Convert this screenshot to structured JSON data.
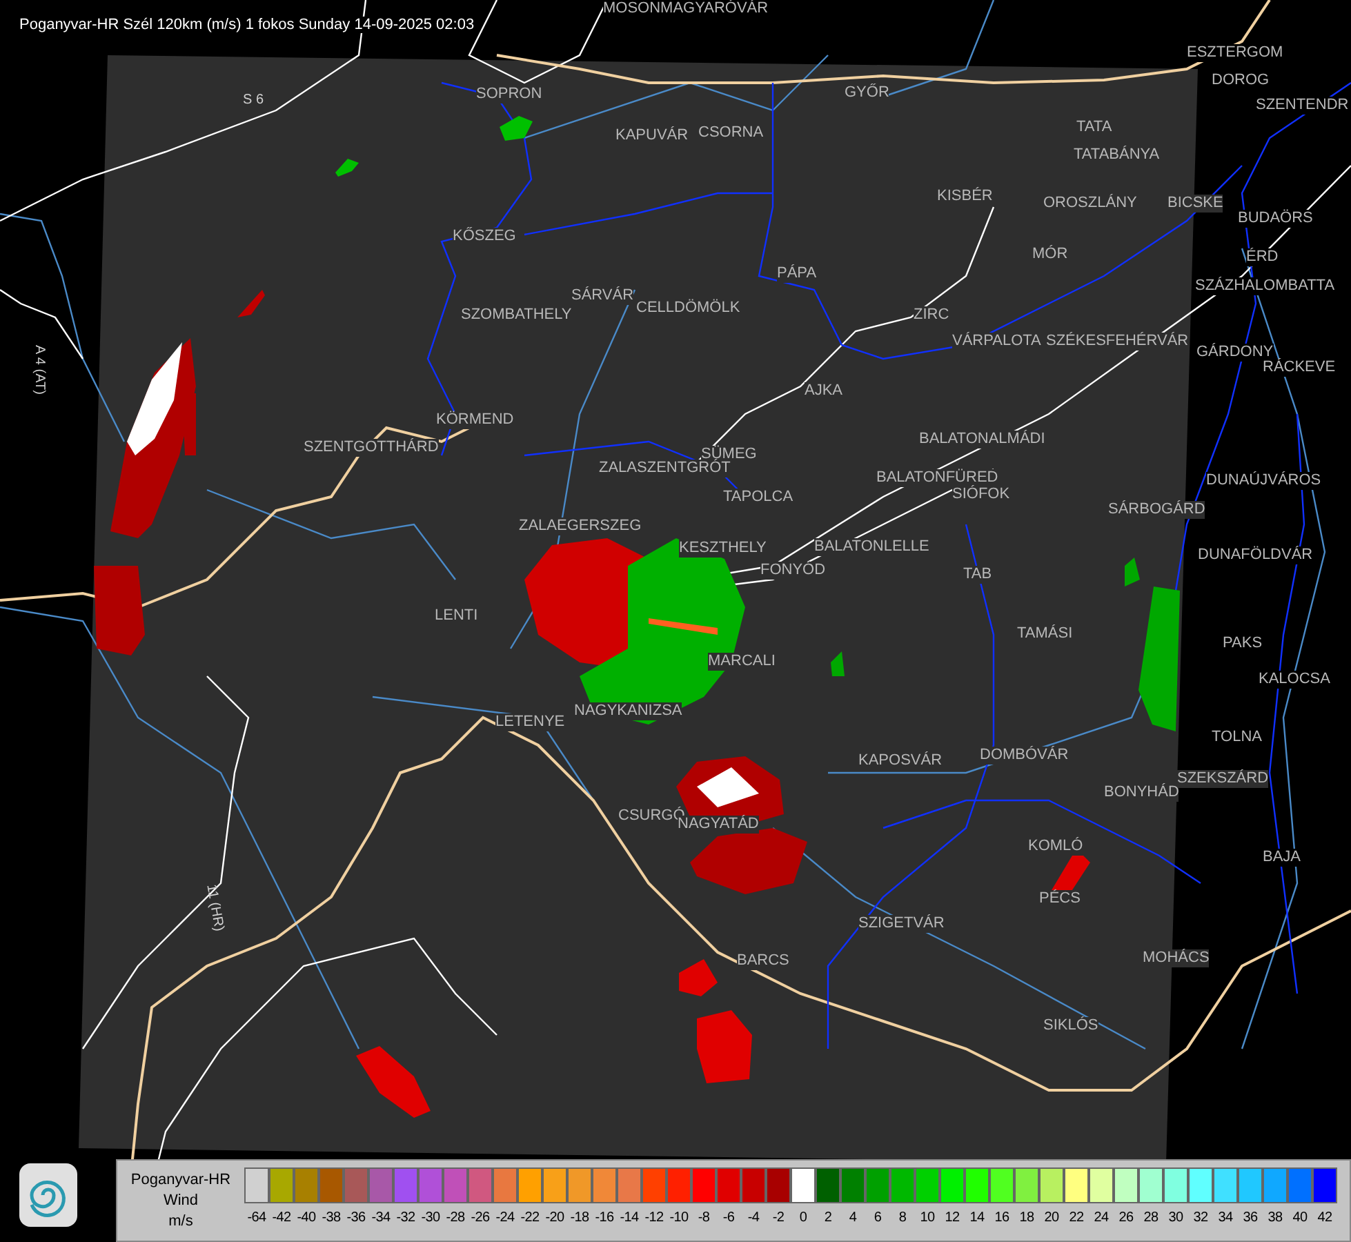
{
  "title": "Poganyvar-HR Szél 120km (m/s) 1 fokos Sunday 14-09-2025 02:03",
  "map_labels": [
    {
      "text": "MOSONMAGYARÓVÁR"
    },
    {
      "text": "SOPRON"
    },
    {
      "text": "GYŐR"
    },
    {
      "text": "KAPUVÁR"
    },
    {
      "text": "CSORNA"
    },
    {
      "text": "ESZTERGOM"
    },
    {
      "text": "DOROG"
    },
    {
      "text": "SZENTENDR"
    },
    {
      "text": "TATA"
    },
    {
      "text": "TATABÁNYA"
    },
    {
      "text": "KISBÉR"
    },
    {
      "text": "OROSZLÁNY"
    },
    {
      "text": "BICSKE"
    },
    {
      "text": "BUDAÖRS"
    },
    {
      "text": "MÓR"
    },
    {
      "text": "ÉRD"
    },
    {
      "text": "SZÁZHALOMBATTA"
    },
    {
      "text": "PÁPA"
    },
    {
      "text": "KŐSZEG"
    },
    {
      "text": "SZOMBATHELY"
    },
    {
      "text": "SÁRVÁR"
    },
    {
      "text": "CELLDÖMÖLK"
    },
    {
      "text": "ZIRC"
    },
    {
      "text": "VÁRPALOTA"
    },
    {
      "text": "SZÉKESFEHÉRVÁR"
    },
    {
      "text": "GÁRDONY"
    },
    {
      "text": "RÁCKEVE"
    },
    {
      "text": "AJKA"
    },
    {
      "text": "KÖRMEND"
    },
    {
      "text": "SZENTGOTTHÁRD"
    },
    {
      "text": "BALATONALMÁDI"
    },
    {
      "text": "SÜMEG"
    },
    {
      "text": "ZALASZENTGRÓT"
    },
    {
      "text": "BALATONFÜRED"
    },
    {
      "text": "SIÓFOK"
    },
    {
      "text": "DUNAÚJVÁROS"
    },
    {
      "text": "TAPOLCA"
    },
    {
      "text": "SÁRBOGÁRD"
    },
    {
      "text": "ZALAEGERSZEG"
    },
    {
      "text": "KESZTHELY"
    },
    {
      "text": "BALATONLELLE"
    },
    {
      "text": "FONYÓD"
    },
    {
      "text": "DUNAFÖLDVÁR"
    },
    {
      "text": "TAB"
    },
    {
      "text": "TAMÁSI"
    },
    {
      "text": "PAKS"
    },
    {
      "text": "LENTI"
    },
    {
      "text": "MARCALI"
    },
    {
      "text": "KALOCSA"
    },
    {
      "text": "NAGYKANIZSA"
    },
    {
      "text": "LETENYE"
    },
    {
      "text": "TOLNA"
    },
    {
      "text": "KAPOSVÁR"
    },
    {
      "text": "DOMBÓVÁR"
    },
    {
      "text": "SZEKSZÁRD"
    },
    {
      "text": "BONYHÁD"
    },
    {
      "text": "CSURGÓ"
    },
    {
      "text": "NAGYATÁD"
    },
    {
      "text": "KOMLÓ"
    },
    {
      "text": "BAJA"
    },
    {
      "text": "PÉCS"
    },
    {
      "text": "SZIGETVÁR"
    },
    {
      "text": "MOHÁCS"
    },
    {
      "text": "BARCS"
    },
    {
      "text": "SIKLÓS"
    }
  ],
  "road_labels": [
    {
      "text": "S 6"
    },
    {
      "text": "A 4 (AT)"
    },
    {
      "text": "11 (HR)"
    }
  ],
  "legend": {
    "title": "Poganyvar-HR",
    "subtitle": "Wind",
    "unit": "m/s",
    "items": [
      {
        "label": "-64",
        "color": "#d0d0d0"
      },
      {
        "label": "-42",
        "color": "#a8a800"
      },
      {
        "label": "-40",
        "color": "#a88000"
      },
      {
        "label": "-38",
        "color": "#a85800"
      },
      {
        "label": "-36",
        "color": "#a85858"
      },
      {
        "label": "-34",
        "color": "#a858a8"
      },
      {
        "label": "-32",
        "color": "#a050f0"
      },
      {
        "label": "-30",
        "color": "#b050d8"
      },
      {
        "label": "-28",
        "color": "#c050b8"
      },
      {
        "label": "-26",
        "color": "#d05880"
      },
      {
        "label": "-24",
        "color": "#e87840"
      },
      {
        "label": "-22",
        "color": "#ffa000"
      },
      {
        "label": "-20",
        "color": "#f8a018"
      },
      {
        "label": "-18",
        "color": "#f09828"
      },
      {
        "label": "-16",
        "color": "#f08838"
      },
      {
        "label": "-14",
        "color": "#e87848"
      },
      {
        "label": "-12",
        "color": "#ff4000"
      },
      {
        "label": "-10",
        "color": "#ff2000"
      },
      {
        "label": "-8",
        "color": "#ff0000"
      },
      {
        "label": "-6",
        "color": "#e00000"
      },
      {
        "label": "-4",
        "color": "#c80000"
      },
      {
        "label": "-2",
        "color": "#a80000"
      },
      {
        "label": "0",
        "color": "#ffffff"
      },
      {
        "label": "2",
        "color": "#006000"
      },
      {
        "label": "4",
        "color": "#008000"
      },
      {
        "label": "6",
        "color": "#00a000"
      },
      {
        "label": "8",
        "color": "#00b800"
      },
      {
        "label": "10",
        "color": "#00d000"
      },
      {
        "label": "12",
        "color": "#00f000"
      },
      {
        "label": "14",
        "color": "#20ff00"
      },
      {
        "label": "16",
        "color": "#50ff20"
      },
      {
        "label": "18",
        "color": "#80f040"
      },
      {
        "label": "20",
        "color": "#b8f060"
      },
      {
        "label": "22",
        "color": "#ffff80"
      },
      {
        "label": "24",
        "color": "#e0ffa0"
      },
      {
        "label": "26",
        "color": "#c0ffc0"
      },
      {
        "label": "28",
        "color": "#a0ffd0"
      },
      {
        "label": "30",
        "color": "#80ffe0"
      },
      {
        "label": "32",
        "color": "#60ffff"
      },
      {
        "label": "34",
        "color": "#40e0ff"
      },
      {
        "label": "36",
        "color": "#20c8ff"
      },
      {
        "label": "38",
        "color": "#10a8ff"
      },
      {
        "label": "40",
        "color": "#0070ff"
      },
      {
        "label": "42",
        "color": "#0000ff"
      }
    ]
  }
}
